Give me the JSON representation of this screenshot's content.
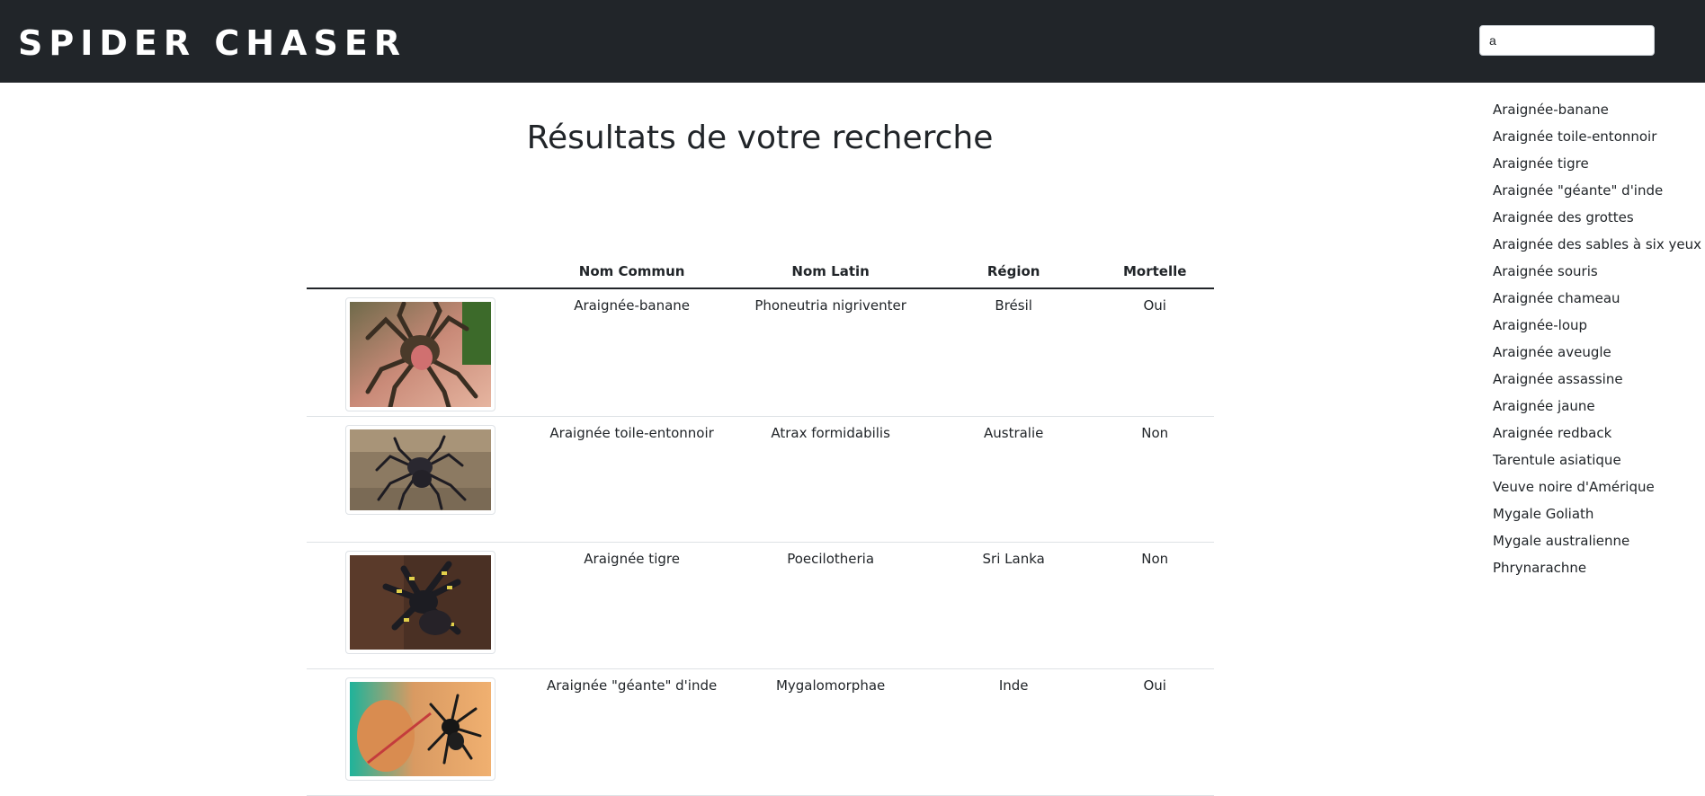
{
  "header": {
    "logo_text": "SPIDER CHASER",
    "search_value": "a"
  },
  "main": {
    "title": "Résultats de votre recherche",
    "columns": [
      "",
      "Nom Commun",
      "Nom Latin",
      "Région",
      "Mortelle"
    ],
    "rows": [
      {
        "common": "Araignée-banane",
        "latin": "Phoneutria nigriventer",
        "region": "Brésil",
        "deadly": "Oui",
        "image": "banana-spider-photo"
      },
      {
        "common": "Araignée toile-entonnoir",
        "latin": "Atrax formidabilis",
        "region": "Australie",
        "deadly": "Non",
        "image": "funnel-web-spider-photo"
      },
      {
        "common": "Araignée tigre",
        "latin": "Poecilotheria",
        "region": "Sri Lanka",
        "deadly": "Non",
        "image": "tiger-spider-photo"
      },
      {
        "common": "Araignée \"géante\" d'inde",
        "latin": "Mygalomorphae",
        "region": "Inde",
        "deadly": "Oui",
        "image": "giant-india-spider-photo"
      }
    ]
  },
  "suggestions": [
    "Araignée-banane",
    "Araignée toile-entonnoir",
    "Araignée tigre",
    "Araignée \"géante\" d'inde",
    "Araignée des grottes",
    "Araignée des sables à six yeux",
    "Araignée souris",
    "Araignée chameau",
    "Araignée-loup",
    "Araignée aveugle",
    "Araignée assassine",
    "Araignée jaune",
    "Araignée redback",
    "Tarentule asiatique",
    "Veuve noire d'Amérique",
    "Mygale Goliath",
    "Mygale australienne",
    "Phrynarachne"
  ]
}
